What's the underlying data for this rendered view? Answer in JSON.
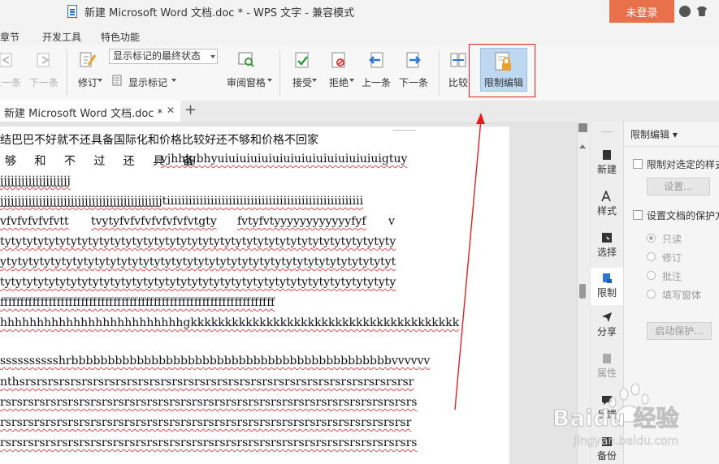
{
  "window": {
    "title": "新建 Microsoft Word 文档.doc * - WPS 文字 - 兼容模式",
    "login_label": "未登录"
  },
  "menu": {
    "items": [
      "章节",
      "开发工具",
      "特色功能"
    ]
  },
  "ribbon": {
    "prev_change": "上一条",
    "next_change": "下一条",
    "revise": "修订",
    "markup_mode": "显示标记的最终状态",
    "show_markup": "显示标记",
    "review_pane": "审阅窗格",
    "accept": "接受",
    "reject": "拒绝",
    "prev": "上一条",
    "next": "下一条",
    "compare": "比较",
    "restrict_edit": "限制编辑"
  },
  "tabs": {
    "doc_tab": "新建 Microsoft Word 文档.doc *",
    "close": "✕",
    "new_tab": "+"
  },
  "document": {
    "lines": [
      "结巴巴不好就不还具备国际化和价格比较好还不够和价格不回家",
      "够 和 不 过 还 具 备",
      "vjhhjgbhyuiuiuiuiuiuiuiuiuiuiuiuiuiuiuigtuy",
      "jjjjjjjjjjjjjjjjjjjj",
      "jjjjjjjjjjjjjjjjjjjjjjjjjjjjjjjjjjjjjjjjjjjjjjtiiiiiiiiiiiiiiiiiiiiiiiiiiiiiiiiiiiiiiiiiiiiiiiiiiiiii",
      "vfvfvfvfvfvtt",
      "tvytyfvfvfvfvfvfvfvtgty",
      "fvtyfvtyyyyyyyyyyyyfyf",
      "v",
      "tytytytytytytytytytytytytytytytytytytytytytytytytytytytytytytytytytytyty",
      "ytytytytytytytytytytytytytytytytytytytytytytytytytytytytytytytytytytytyt",
      "tytytytytytytytytytytytytytytytytytytytytytytytytytytytytytytytytytytyty",
      "ffffffffffffffffffffffffffffffffffffffffffffffffffffffffffffffffffff",
      "hhhhhhhhhhhhhhhhhhhhhhhhhgkkkkkkkkkkkkkkkkkkkkkkkkkkkkkkkkkkkkkkk",
      "sssssssssshrbbbbbbbbbbbbbbbbbbbbbbbbbbbbbbbbbbbbbbbbbbbbvvvvvv",
      "nthsrsrsrsrsrsrsrsrsrsrsrsrsrsrsrsrsrsrsrsrsrsrsrsrsrsrsrsrsrsrsrsrsrsrsr",
      "rsrsrsrsrsrsrsrsrsrsrsrsrsrsrsrsrsrsrsrsrsrsrsrsrsrsrsrsrsrsrsrsrsrsrsrsrs",
      "rsrsrsrsrsrsrsrsrsrsrsrsrsrsrsrsrsrsrsrsrsrsrsrsrsrsrsrsrsrsrsrsrsrsrsrsr",
      "rsrsrsrsrsrsrsrsrsrsrsrsrsrsrsrsrsrsrsrsrsrsrsrsrsrsrsrsrsrsrsrsrsrsrsrsrs"
    ]
  },
  "sidebar": {
    "items": [
      "新建",
      "样式",
      "选择",
      "限制",
      "分享",
      "属性",
      "反馈",
      "备份"
    ]
  },
  "pane": {
    "title": "限制编辑 ▾",
    "restrict_format": "限制对选定的样式",
    "settings": "设置...",
    "protect_doc": "设置文档的保护方",
    "read_only": "只读",
    "revisions": "修订",
    "comments": "批注",
    "forms": "填写窗体",
    "start_protect": "启动保护..."
  },
  "watermark": {
    "brand": "Baidu 经验",
    "url": "jingyan.baidu.com"
  },
  "colors": {
    "login_bg": "#e8704a",
    "highlight_border": "#e02020",
    "active_button_bg": "#bfd8f2",
    "spell_underline": "#e05050"
  }
}
